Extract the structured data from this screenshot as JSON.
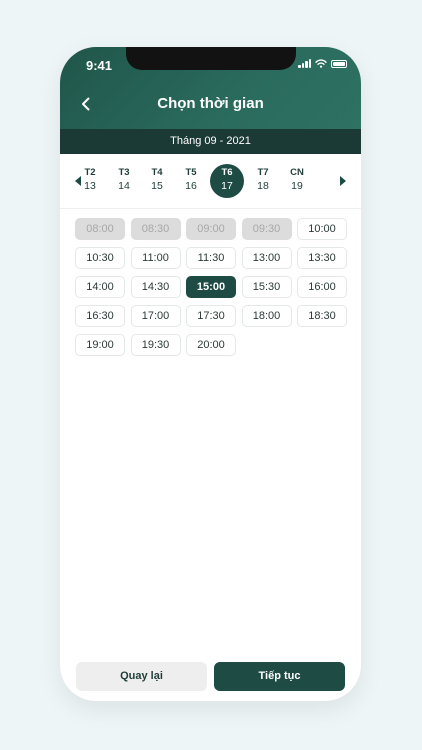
{
  "status": {
    "time": "9:41"
  },
  "header": {
    "title": "Chọn thời gian",
    "back_icon": "chevron-left-icon"
  },
  "month_label": "Tháng 09 - 2021",
  "week": {
    "prev_icon": "caret-left-icon",
    "next_icon": "caret-right-icon",
    "days": [
      {
        "name": "T2",
        "date": "13"
      },
      {
        "name": "T3",
        "date": "14"
      },
      {
        "name": "T4",
        "date": "15"
      },
      {
        "name": "T5",
        "date": "16"
      },
      {
        "name": "T6",
        "date": "17",
        "selected": true
      },
      {
        "name": "T7",
        "date": "18"
      },
      {
        "name": "CN",
        "date": "19"
      }
    ]
  },
  "slots": [
    {
      "time": "08:00",
      "state": "disabled"
    },
    {
      "time": "08:30",
      "state": "disabled"
    },
    {
      "time": "09:00",
      "state": "disabled"
    },
    {
      "time": "09:30",
      "state": "disabled"
    },
    {
      "time": "10:00",
      "state": "available"
    },
    {
      "time": "10:30",
      "state": "available"
    },
    {
      "time": "11:00",
      "state": "available"
    },
    {
      "time": "11:30",
      "state": "available"
    },
    {
      "time": "13:00",
      "state": "available"
    },
    {
      "time": "13:30",
      "state": "available"
    },
    {
      "time": "14:00",
      "state": "available"
    },
    {
      "time": "14:30",
      "state": "available"
    },
    {
      "time": "15:00",
      "state": "selected"
    },
    {
      "time": "15:30",
      "state": "available"
    },
    {
      "time": "16:00",
      "state": "available"
    },
    {
      "time": "16:30",
      "state": "available"
    },
    {
      "time": "17:00",
      "state": "available"
    },
    {
      "time": "17:30",
      "state": "available"
    },
    {
      "time": "18:00",
      "state": "available"
    },
    {
      "time": "18:30",
      "state": "available"
    },
    {
      "time": "19:00",
      "state": "available"
    },
    {
      "time": "19:30",
      "state": "available"
    },
    {
      "time": "20:00",
      "state": "available"
    }
  ],
  "footer": {
    "back_label": "Quay lại",
    "next_label": "Tiếp tục"
  },
  "colors": {
    "primary": "#1e4b44",
    "header": "#2a6b5d",
    "month_bar": "#1b3a35",
    "disabled": "#dcdcdc"
  }
}
